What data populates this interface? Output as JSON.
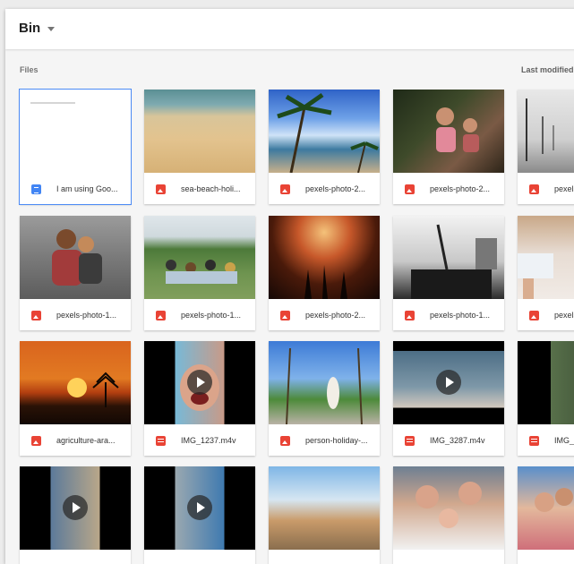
{
  "header": {
    "title": "Bin"
  },
  "section": {
    "label": "Files",
    "sort_label": "Last modified"
  },
  "files": [
    {
      "name": "I am using Goo...",
      "type": "doc",
      "selected": true
    },
    {
      "name": "sea-beach-holi...",
      "type": "image"
    },
    {
      "name": "pexels-photo-2...",
      "type": "image"
    },
    {
      "name": "pexels-photo-2...",
      "type": "image"
    },
    {
      "name": "pexels-photo-...",
      "type": "image"
    },
    {
      "name": "pexels-photo-1...",
      "type": "image"
    },
    {
      "name": "pexels-photo-1...",
      "type": "image"
    },
    {
      "name": "pexels-photo-2...",
      "type": "image"
    },
    {
      "name": "pexels-photo-1...",
      "type": "image"
    },
    {
      "name": "pexels-photo-...",
      "type": "image"
    },
    {
      "name": "agriculture-ara...",
      "type": "image"
    },
    {
      "name": "IMG_1237.m4v",
      "type": "video"
    },
    {
      "name": "person-holiday-...",
      "type": "image"
    },
    {
      "name": "IMG_3287.m4v",
      "type": "video"
    },
    {
      "name": "IMG_...",
      "type": "video"
    },
    {
      "name": "",
      "type": "video"
    },
    {
      "name": "",
      "type": "video"
    },
    {
      "name": "",
      "type": "image"
    },
    {
      "name": "",
      "type": "image"
    },
    {
      "name": "",
      "type": "image"
    }
  ],
  "colors": {
    "selected_outline": "#4c8bf5",
    "image_icon": "#e94335",
    "doc_icon": "#4285f4"
  }
}
